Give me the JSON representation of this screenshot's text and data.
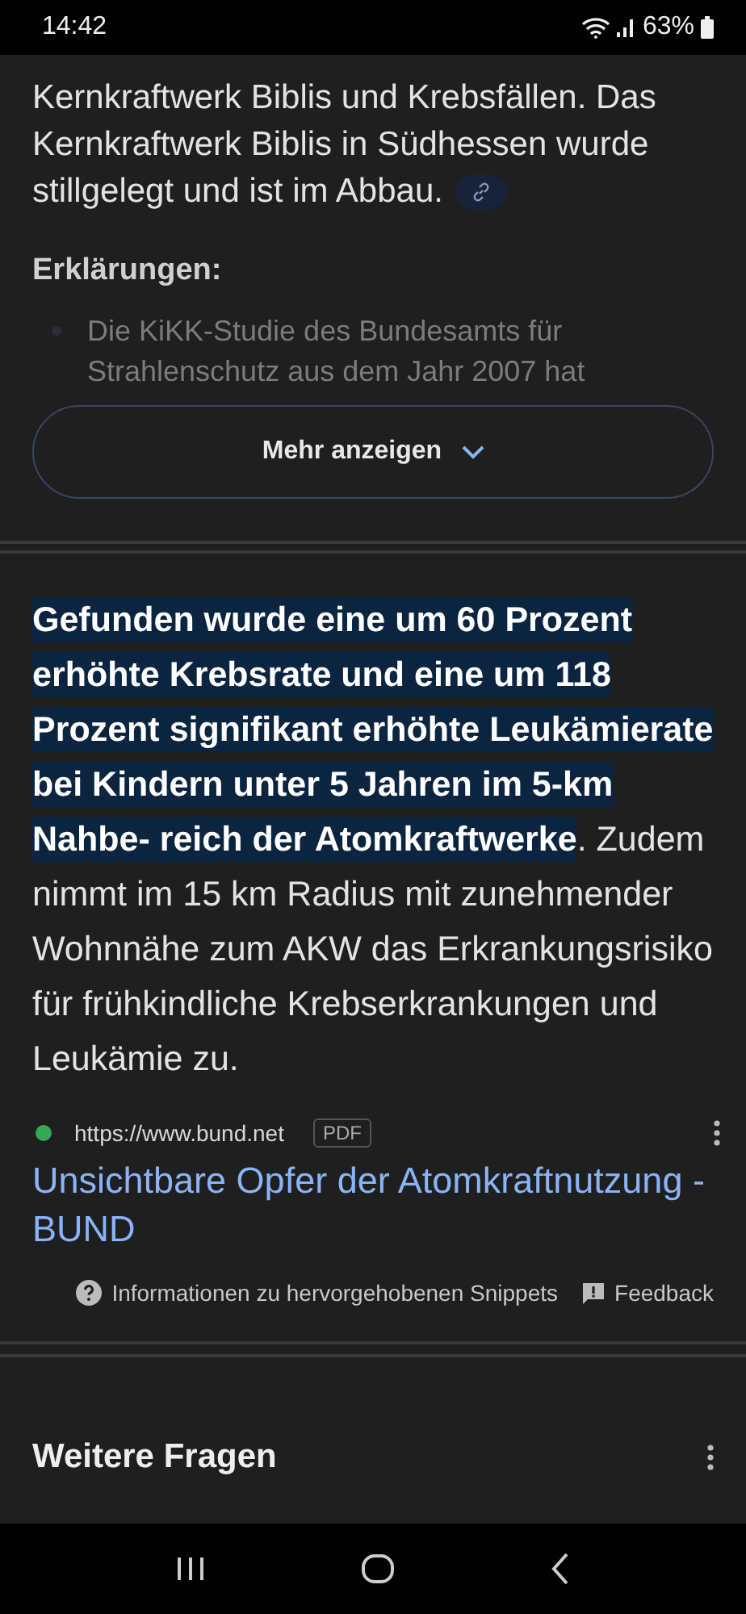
{
  "status_bar": {
    "time": "14:42",
    "battery": "63%"
  },
  "answer": {
    "paragraph": "Kernkraftwerk Biblis und Krebsfällen. Das Kernkraftwerk Biblis in Südhessen wurde stillgelegt und ist im Abbau.",
    "heading": "Erklärungen:",
    "bullets": [
      "Die KiKK-Studie des Bundesamts für Strahlenschutz aus dem Jahr 2007 hat"
    ],
    "more_button": "Mehr anzeigen"
  },
  "snippet": {
    "highlighted": "Gefunden wurde eine um 60 Prozent erhöhte Krebsrate und eine um 118 Prozent signifikant erhöhte Leukämierate bei Kindern unter 5 Jahren im 5-km Nahbe- reich der Atomkraftwerke",
    "rest": ". Zudem nimmt im 15 km Radius mit zunehmender Wohnnähe zum AKW das Erkrankungsrisiko für frühkindliche Krebserkrankungen und Leukämie zu.",
    "source_url": "https://www.bund.net",
    "badge": "PDF",
    "title": "Unsichtbare Opfer der Atomkraftnutzung - BUND",
    "info": "Informationen zu hervorgehobenen Snippets",
    "feedback": "Feedback"
  },
  "more_questions": {
    "heading": "Weitere Fragen"
  }
}
